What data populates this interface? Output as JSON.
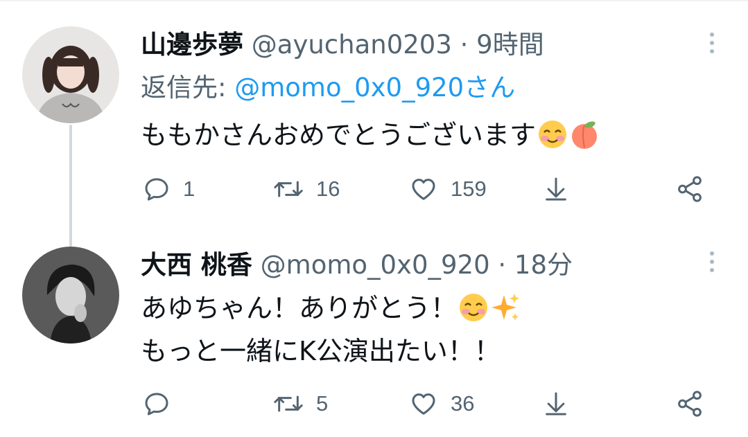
{
  "tweets": [
    {
      "name": "山邊歩夢",
      "handle": "@ayuchan0203",
      "separator": "·",
      "time": "9時間",
      "reply_label": "返信先:",
      "reply_mention": "@momo_0x0_920さん",
      "lines": [
        "ももかさんおめでとうございます"
      ],
      "emoji_line1": [
        "smiling-blush-emoji",
        "peach-emoji"
      ],
      "actions": {
        "reply": "1",
        "retweet": "16",
        "like": "159"
      }
    },
    {
      "name": "大西 桃香",
      "handle": "@momo_0x0_920",
      "separator": "·",
      "time": "18分",
      "lines": [
        "あゆちゃん！ありがとう！",
        "もっと一緒にK公演出たい！！"
      ],
      "emoji_line1": [
        "smiling-blush-emoji",
        "sparkles-emoji"
      ],
      "actions": {
        "reply": "",
        "retweet": "5",
        "like": "36"
      }
    }
  ],
  "colors": {
    "accent": "#1d9bf0",
    "secondary_text": "#536471",
    "thread_line": "#cfd9de"
  }
}
